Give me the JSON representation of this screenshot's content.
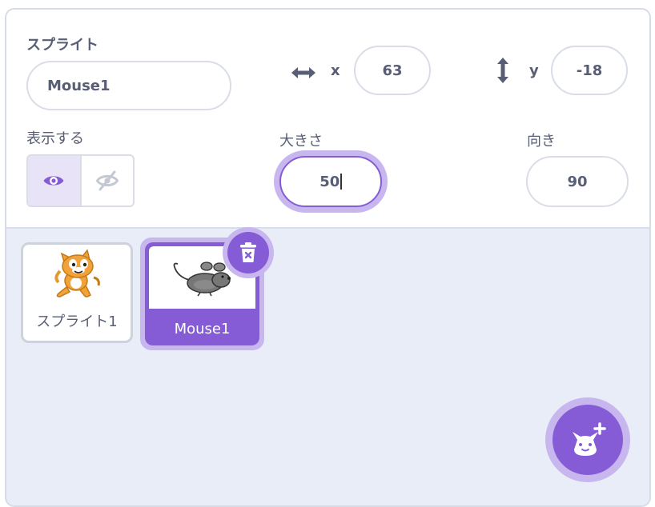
{
  "sprite_info": {
    "sprite_label": "スプライト",
    "sprite_name": "Mouse1",
    "x_label": "x",
    "x_value": "63",
    "y_label": "y",
    "y_value": "-18",
    "show_label": "表示する",
    "show_state": "visible",
    "size_label": "大きさ",
    "size_value": "50",
    "direction_label": "向き",
    "direction_value": "90"
  },
  "sprites": [
    {
      "name": "スプライト1",
      "selected": false,
      "icon": "scratch-cat"
    },
    {
      "name": "Mouse1",
      "selected": true,
      "icon": "mouse"
    }
  ],
  "icons": {
    "x_axis": "horizontal-arrows-icon",
    "y_axis": "vertical-arrows-icon",
    "show": "eye-icon",
    "hide": "eye-slash-icon",
    "delete": "trash-icon",
    "add_sprite": "add-sprite-cat-icon"
  },
  "colors": {
    "accent": "#855cd6",
    "accent_light": "#c8b6ee",
    "text": "#575e75",
    "panel_bg": "#e8edf8"
  }
}
